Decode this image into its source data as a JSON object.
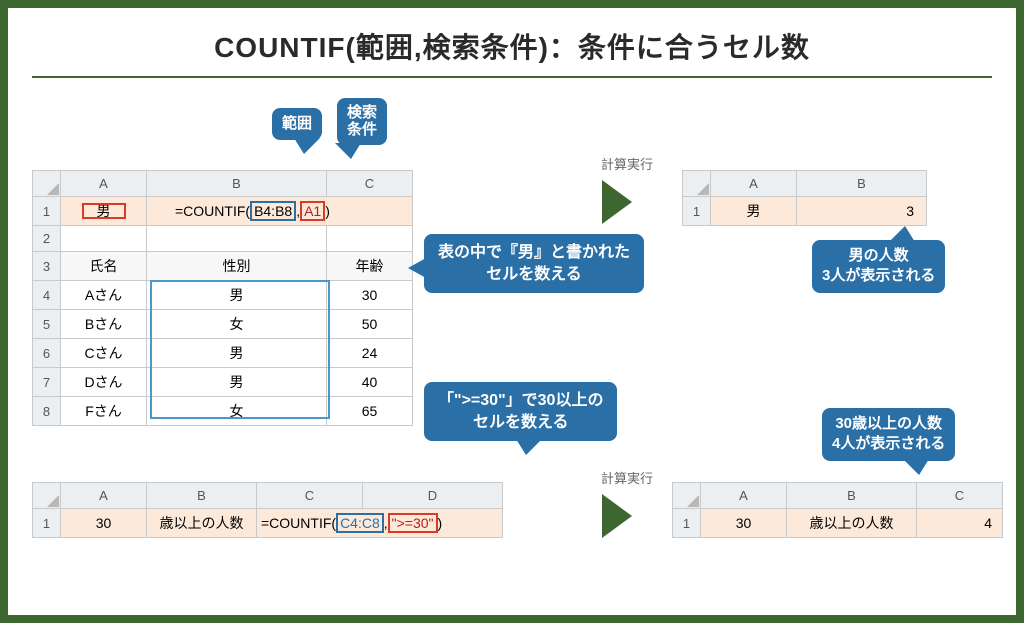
{
  "title": "COUNTIF(範囲,検索条件)：条件に合うセル数",
  "labels": {
    "range": "範囲",
    "criteria_l1": "検索",
    "criteria_l2": "条件",
    "exec": "計算実行"
  },
  "sheet1": {
    "cols": [
      "A",
      "B",
      "C"
    ],
    "rows": [
      "1",
      "2",
      "3",
      "4",
      "5",
      "6",
      "7",
      "8"
    ],
    "A1": "男",
    "formula": {
      "pre": "=COUNTIF(",
      "range": "B4:B8",
      "sep": ",",
      "crit": "A1",
      "post": ")"
    },
    "headers": [
      "氏名",
      "性別",
      "年齢"
    ],
    "data": [
      [
        "Aさん",
        "男",
        "30"
      ],
      [
        "Bさん",
        "女",
        "50"
      ],
      [
        "Cさん",
        "男",
        "24"
      ],
      [
        "Dさん",
        "男",
        "40"
      ],
      [
        "Fさん",
        "女",
        "65"
      ]
    ]
  },
  "result1": {
    "cols": [
      "A",
      "B"
    ],
    "row": "1",
    "A1": "男",
    "B1": "3"
  },
  "sheet2": {
    "cols": [
      "A",
      "B",
      "C",
      "D"
    ],
    "row": "1",
    "A1": "30",
    "B1": "歳以上の人数",
    "formula": {
      "pre": "=COUNTIF(",
      "range": "C4:C8",
      "sep": ",",
      "crit": "\">=30\"",
      "post": ")"
    }
  },
  "result2": {
    "cols": [
      "A",
      "B",
      "C"
    ],
    "row": "1",
    "A1": "30",
    "B1": "歳以上の人数",
    "C1": "4"
  },
  "callouts": {
    "c1_l1": "表の中で『男』と書かれた",
    "c1_l2": "セルを数える",
    "c2_l1": "「\">=30\"」で30以上の",
    "c2_l2": "セルを数える",
    "r1_l1": "男の人数",
    "r1_l2": "3人が表示される",
    "r2_l1": "30歳以上の人数",
    "r2_l2": "4人が表示される"
  }
}
